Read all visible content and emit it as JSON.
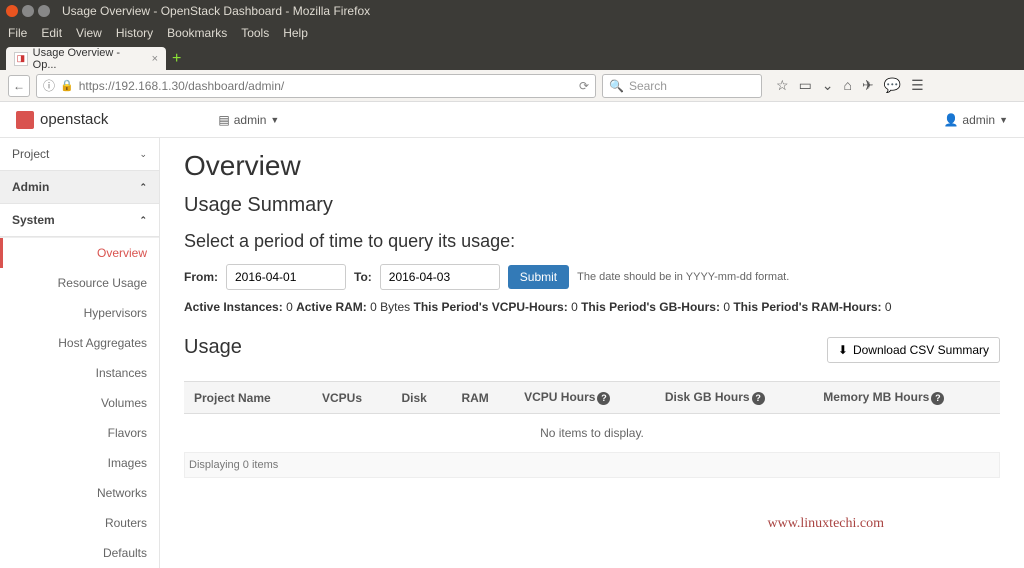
{
  "window": {
    "title": "Usage Overview - OpenStack Dashboard - Mozilla Firefox"
  },
  "menubar": [
    "File",
    "Edit",
    "View",
    "History",
    "Bookmarks",
    "Tools",
    "Help"
  ],
  "tab": {
    "title": "Usage Overview - Op..."
  },
  "urlbar": {
    "url": "https://192.168.1.30/dashboard/admin/",
    "info_glyph": "ⓘ"
  },
  "searchbar": {
    "placeholder": "Search"
  },
  "topbar": {
    "brand": "openstack",
    "domain_glyph": "▤",
    "domain": "admin",
    "user_glyph": "👤",
    "user": "admin"
  },
  "sidebar": {
    "sections": {
      "project": "Project",
      "admin": "Admin",
      "system": "System"
    },
    "items": [
      "Overview",
      "Resource Usage",
      "Hypervisors",
      "Host Aggregates",
      "Instances",
      "Volumes",
      "Flavors",
      "Images",
      "Networks",
      "Routers",
      "Defaults"
    ]
  },
  "main": {
    "h1": "Overview",
    "h2": "Usage Summary",
    "query_title": "Select a period of time to query its usage:",
    "from_label": "From:",
    "from_value": "2016-04-01",
    "to_label": "To:",
    "to_value": "2016-04-03",
    "submit": "Submit",
    "hint": "The date should be in YYYY-mm-dd format.",
    "stats": {
      "active_instances_label": "Active Instances:",
      "active_instances_value": "0",
      "active_ram_label": "Active RAM:",
      "active_ram_value": "0 Bytes",
      "vcpu_hours_label": "This Period's VCPU-Hours:",
      "vcpu_hours_value": "0",
      "gb_hours_label": "This Period's GB-Hours:",
      "gb_hours_value": "0",
      "ram_hours_label": "This Period's RAM-Hours:",
      "ram_hours_value": "0"
    },
    "usage_title": "Usage",
    "csv_button": "Download CSV Summary",
    "table": {
      "headers": [
        "Project Name",
        "VCPUs",
        "Disk",
        "RAM",
        "VCPU Hours",
        "Disk GB Hours",
        "Memory MB Hours"
      ],
      "empty": "No items to display.",
      "footer": "Displaying 0 items"
    }
  },
  "watermark": "www.linuxtechi.com"
}
